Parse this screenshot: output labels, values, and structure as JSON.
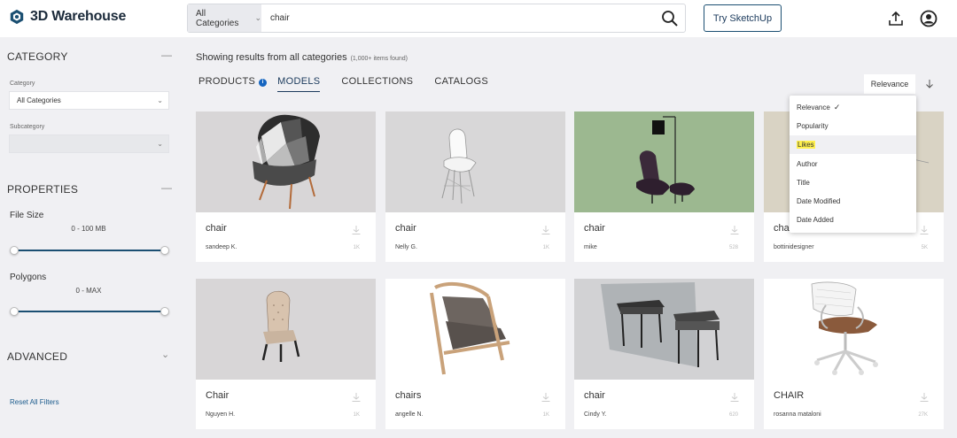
{
  "header": {
    "logo_text": "3D Warehouse",
    "search_category": "All Categories",
    "search_value": "chair",
    "try_button": "Try SketchUp"
  },
  "sidebar": {
    "category_title": "CATEGORY",
    "category_label": "Category",
    "category_value": "All Categories",
    "subcategory_label": "Subcategory",
    "properties_title": "PROPERTIES",
    "file_size_label": "File Size",
    "file_size_value": "0 - 100 MB",
    "polygons_label": "Polygons",
    "polygons_value": "0 - MAX",
    "advanced_title": "ADVANCED",
    "reset_link": "Reset All Filters"
  },
  "main": {
    "results_text": "Showing results from all categories",
    "results_count": "(1,000+ items found)",
    "tabs": [
      {
        "label": "PRODUCTS"
      },
      {
        "label": "MODELS"
      },
      {
        "label": "COLLECTIONS"
      },
      {
        "label": "CATALOGS"
      }
    ],
    "sort_label": "Relevance"
  },
  "sort_menu": {
    "items": [
      {
        "label": "Relevance"
      },
      {
        "label": "Popularity"
      },
      {
        "label": "Likes"
      },
      {
        "label": "Author"
      },
      {
        "label": "Title"
      },
      {
        "label": "Date Modified"
      },
      {
        "label": "Date Added"
      }
    ]
  },
  "cards": [
    {
      "title": "chair",
      "author": "sandeep K.",
      "count": "1K"
    },
    {
      "title": "chair",
      "author": "Nelly G.",
      "count": "1K"
    },
    {
      "title": "chair",
      "author": "mike",
      "count": "528"
    },
    {
      "title": "chair",
      "author": "bottinidesigner",
      "count": "5K"
    },
    {
      "title": "Chair",
      "author": "Nguyen H.",
      "count": "1K"
    },
    {
      "title": "chairs",
      "author": "angelle N.",
      "count": "1K"
    },
    {
      "title": "chair",
      "author": "Cindy Y.",
      "count": "620"
    },
    {
      "title": "CHAIR",
      "author": "rosanna mataloni",
      "count": "27K"
    }
  ],
  "colors": {
    "brand": "#1b4f72",
    "link": "#1b5b8c",
    "info": "#1565c0",
    "highlight": "#fff04d"
  }
}
